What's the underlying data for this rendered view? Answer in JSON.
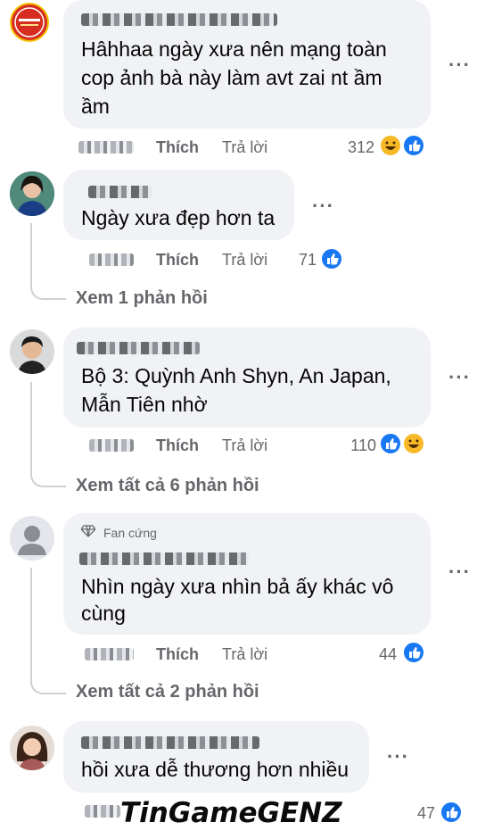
{
  "comments": [
    {
      "text_lines": [
        "Hâhhaa ngày xưa nên mạng toàn",
        "cop ảnh bà này làm avt zai nt ầm",
        "ầm"
      ],
      "like_label": "Thích",
      "reply_label": "Trả lời",
      "reaction_count": "312",
      "reactions": [
        "haha",
        "like"
      ]
    },
    {
      "text_lines": [
        "Ngày xưa đẹp hơn ta"
      ],
      "like_label": "Thích",
      "reply_label": "Trả lời",
      "reaction_count": "71",
      "reactions": [
        "like"
      ],
      "view_replies": "Xem 1 phản hồi"
    },
    {
      "text_lines": [
        "Bộ 3: Quỳnh Anh Shyn, An Japan,",
        "Mẫn Tiên nhờ"
      ],
      "like_label": "Thích",
      "reply_label": "Trả lời",
      "reaction_count": "110",
      "reactions": [
        "like",
        "haha"
      ],
      "view_replies": "Xem tất cả 6 phản hồi"
    },
    {
      "badge": "Fan cứng",
      "text_lines": [
        "Nhìn ngày xưa nhìn bả ấy khác vô",
        "cùng"
      ],
      "like_label": "Thích",
      "reply_label": "Trả lời",
      "reaction_count": "44",
      "reactions": [
        "like"
      ],
      "view_replies": "Xem tất cả 2 phản hồi"
    },
    {
      "text_lines": [
        "hồi xưa dễ thương hơn nhiều"
      ],
      "reaction_count": "47",
      "reactions": [
        "like"
      ]
    }
  ],
  "more_options_label": "···",
  "watermark": "TinGameGENZ",
  "colors": {
    "bubble": "#f0f2f5",
    "like": "#1877f2",
    "haha": "#f7b928",
    "meta": "#65676b"
  }
}
